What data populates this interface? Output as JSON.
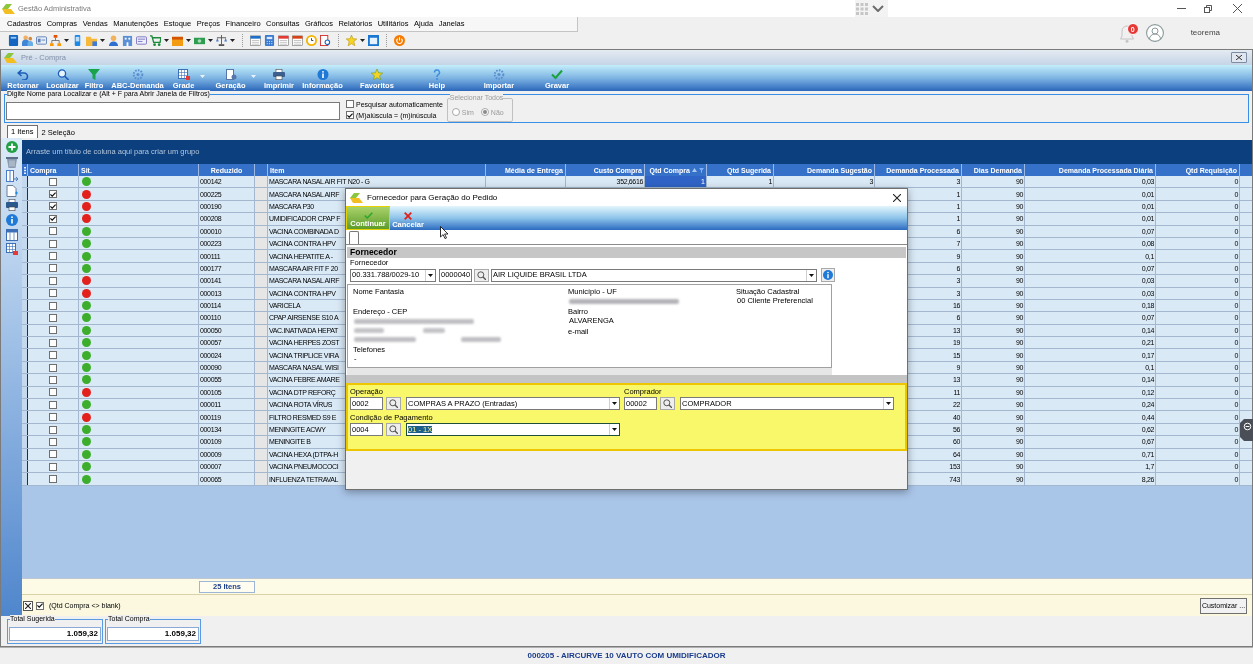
{
  "app": {
    "title": "Gestão Administrativa",
    "notifications": "0",
    "user": "teorema"
  },
  "menu": [
    "Cadastros",
    "Compras",
    "Vendas",
    "Manutenções",
    "Estoque",
    "Preços",
    "Financeiro",
    "Consultas",
    "Gráficos",
    "Relatórios",
    "Utilitários",
    "Ajuda",
    "Janelas"
  ],
  "window": {
    "title": "Pré - Compra"
  },
  "actions": [
    {
      "label": "Retornar",
      "dropdown": false
    },
    {
      "label": "Localizar",
      "dropdown": false
    },
    {
      "label": "Filtro",
      "dropdown": false
    },
    {
      "label": "ABC-Demanda",
      "dropdown": false
    },
    {
      "label": "Grade",
      "dropdown": true
    },
    {
      "label": "Geração",
      "dropdown": true
    },
    {
      "label": "Imprimir",
      "dropdown": false
    },
    {
      "label": "Informação",
      "dropdown": false
    },
    {
      "label": "Favoritos",
      "dropdown": false
    },
    {
      "label": "Help",
      "dropdown": false
    },
    {
      "label": "Importar",
      "dropdown": false
    },
    {
      "label": "Gravar",
      "dropdown": false
    }
  ],
  "search": {
    "label": "Digite Nome para Localizar e (Alt + F para Abrir Janela de Filtros)",
    "options": [
      {
        "label": "Pesquisar automaticamente",
        "checked": false
      },
      {
        "label": "(M)aiúscula = (m)inúscula",
        "checked": true
      }
    ],
    "select_all": {
      "title": "Selecionar Todos",
      "disabled": true,
      "options": [
        {
          "label": "Sim",
          "selected": false
        },
        {
          "label": "Não",
          "selected": true
        }
      ]
    }
  },
  "tabs": [
    {
      "label": "1 Itens",
      "selected": true
    },
    {
      "label": "2 Seleção",
      "selected": false
    }
  ],
  "grid": {
    "group_hint": "Arraste um título de coluna aqui para criar um grupo",
    "columns": [
      {
        "label": "Compra",
        "kind": "check"
      },
      {
        "label": "Sit.",
        "kind": "status"
      },
      {
        "label": "Reduzido",
        "kind": "code"
      },
      {
        "kind": "blank"
      },
      {
        "label": "Item",
        "kind": "text"
      },
      {
        "label": "Média de Entrega",
        "kind": "number"
      },
      {
        "label": "Custo Compra",
        "kind": "number"
      },
      {
        "label": "Qtd Compra",
        "kind": "number",
        "sort_ascending": true,
        "filtered": true
      },
      {
        "label": "Qtd Sugerida",
        "kind": "number"
      },
      {
        "label": "Demanda Sugestão",
        "kind": "number"
      },
      {
        "label": "Demanda Processada",
        "kind": "number"
      },
      {
        "label": "Dias Demanda",
        "kind": "number"
      },
      {
        "label": "Demanda Processada Diária",
        "kind": "number"
      },
      {
        "label": "Qtd Requisição",
        "kind": "number"
      }
    ],
    "rows": [
      {
        "cells": [
          {
            "checked": false
          },
          {
            "color": "#3cae2c"
          },
          "000142",
          "",
          "MASCARA NASAL AIR FIT N20 - G",
          "",
          "352,6616",
          {
            "text": "1",
            "selected": true
          },
          "1",
          "3",
          "3",
          "90",
          "0,03",
          "0"
        ]
      },
      {
        "cells": [
          {
            "checked": true
          },
          {
            "color": "#e3211c"
          },
          "000225",
          "",
          "MASCARA NASAL AIRF",
          "",
          "",
          "",
          "",
          "",
          "1",
          "90",
          "0,01",
          "0"
        ]
      },
      {
        "cells": [
          {
            "checked": true
          },
          {
            "color": "#e3211c"
          },
          "000190",
          "",
          "MASCARA P30",
          "",
          "",
          "",
          "",
          "",
          "1",
          "90",
          "0,01",
          "0"
        ]
      },
      {
        "cells": [
          {
            "checked": true
          },
          {
            "color": "#e3211c"
          },
          "000208",
          "",
          "UMIDIFICADOR CPAP F",
          "",
          "",
          "",
          "",
          "",
          "1",
          "90",
          "0,01",
          "0"
        ]
      },
      {
        "cells": [
          {
            "checked": false
          },
          {
            "color": "#3cae2c"
          },
          "000010",
          "",
          "VACINA COMBINADA D",
          "",
          "",
          "",
          "",
          "",
          "6",
          "90",
          "0,07",
          "0"
        ]
      },
      {
        "cells": [
          {
            "checked": false
          },
          {
            "color": "#3cae2c"
          },
          "000223",
          "",
          "VACINA CONTRA HPV",
          "",
          "",
          "",
          "",
          "",
          "7",
          "90",
          "0,08",
          "0"
        ]
      },
      {
        "cells": [
          {
            "checked": false
          },
          {
            "color": "#3cae2c"
          },
          "000111",
          "",
          "VACINA HEPATITE A -",
          "",
          "",
          "",
          "",
          "",
          "9",
          "90",
          "0,1",
          "0"
        ]
      },
      {
        "cells": [
          {
            "checked": false
          },
          {
            "color": "#3cae2c"
          },
          "000177",
          "",
          "MASCARA AIR FIT F 20",
          "",
          "",
          "",
          "",
          "",
          "6",
          "90",
          "0,07",
          "0"
        ]
      },
      {
        "cells": [
          {
            "checked": false
          },
          {
            "color": "#e3211c"
          },
          "000141",
          "",
          "MASCARA NASAL AIRF",
          "",
          "",
          "",
          "",
          "",
          "3",
          "90",
          "0,03",
          "0"
        ]
      },
      {
        "cells": [
          {
            "checked": false
          },
          {
            "color": "#e3211c"
          },
          "000013",
          "",
          "VACINA CONTRA HPV",
          "",
          "",
          "",
          "",
          "",
          "3",
          "90",
          "0,03",
          "0"
        ]
      },
      {
        "cells": [
          {
            "checked": false
          },
          {
            "color": "#3cae2c"
          },
          "000114",
          "",
          "VARICELA",
          "",
          "",
          "",
          "",
          "",
          "16",
          "90",
          "0,18",
          "0"
        ]
      },
      {
        "cells": [
          {
            "checked": false
          },
          {
            "color": "#3cae2c"
          },
          "000110",
          "",
          "CPAP AIRSENSE S10 A",
          "",
          "",
          "",
          "",
          "",
          "6",
          "90",
          "0,07",
          "0"
        ]
      },
      {
        "cells": [
          {
            "checked": false
          },
          {
            "color": "#3cae2c"
          },
          "000050",
          "",
          "VAC.INATIVADA HEPAT",
          "",
          "",
          "",
          "",
          "",
          "13",
          "90",
          "0,14",
          "0"
        ]
      },
      {
        "cells": [
          {
            "checked": false
          },
          {
            "color": "#3cae2c"
          },
          "000057",
          "",
          "VACINA HERPES ZOST",
          "",
          "",
          "",
          "",
          "",
          "19",
          "90",
          "0,21",
          "0"
        ]
      },
      {
        "cells": [
          {
            "checked": false
          },
          {
            "color": "#3cae2c"
          },
          "000024",
          "",
          "VACINA TRIPLICE VIRA",
          "",
          "",
          "",
          "",
          "",
          "15",
          "90",
          "0,17",
          "0"
        ]
      },
      {
        "cells": [
          {
            "checked": false
          },
          {
            "color": "#3cae2c"
          },
          "000090",
          "",
          "MASCARA NASAL WISI",
          "",
          "",
          "",
          "",
          "",
          "9",
          "90",
          "0,1",
          "0"
        ]
      },
      {
        "cells": [
          {
            "checked": false
          },
          {
            "color": "#3cae2c"
          },
          "000055",
          "",
          "VACINA FEBRE AMARE",
          "",
          "",
          "",
          "",
          "",
          "13",
          "90",
          "0,14",
          "0"
        ]
      },
      {
        "cells": [
          {
            "checked": false
          },
          {
            "color": "#e3211c"
          },
          "000105",
          "",
          "VACINA DTP REFORÇ",
          "",
          "",
          "",
          "",
          "",
          "11",
          "90",
          "0,12",
          "0"
        ]
      },
      {
        "cells": [
          {
            "checked": false
          },
          {
            "color": "#3cae2c"
          },
          "000011",
          "",
          "VACINA ROTA VÍRUS",
          "",
          "",
          "",
          "",
          "",
          "22",
          "90",
          "0,24",
          "0"
        ]
      },
      {
        "cells": [
          {
            "checked": false
          },
          {
            "color": "#e3211c"
          },
          "000119",
          "",
          "FILTRO RESMED S9 E",
          "",
          "",
          "",
          "",
          "",
          "40",
          "90",
          "0,44",
          "0"
        ]
      },
      {
        "cells": [
          {
            "checked": false
          },
          {
            "color": "#3cae2c"
          },
          "000134",
          "",
          "MENINGITE ACWY",
          "",
          "",
          "",
          "",
          "",
          "56",
          "90",
          "0,62",
          "0"
        ]
      },
      {
        "cells": [
          {
            "checked": false
          },
          {
            "color": "#3cae2c"
          },
          "000109",
          "",
          "MENINGITE B",
          "",
          "",
          "",
          "",
          "",
          "60",
          "90",
          "0,67",
          "0"
        ]
      },
      {
        "cells": [
          {
            "checked": false
          },
          {
            "color": "#3cae2c"
          },
          "000009",
          "",
          "VACINA HEXA (DTPA-H",
          "",
          "",
          "",
          "",
          "",
          "64",
          "90",
          "0,71",
          "0"
        ]
      },
      {
        "cells": [
          {
            "checked": false
          },
          {
            "color": "#3cae2c"
          },
          "000007",
          "",
          "VACINA PNEUMOCOCI",
          "",
          "",
          "",
          "",
          "",
          "153",
          "90",
          "1,7",
          "0"
        ]
      },
      {
        "cells": [
          {
            "checked": false
          },
          {
            "color": "#3cae2c"
          },
          "000065",
          "",
          "INFLUENZA TETRAVAL",
          "",
          "",
          "",
          "",
          "",
          "743",
          "90",
          "8,26",
          "0"
        ]
      }
    ],
    "row_count": "25 Itens",
    "filter": {
      "active": true,
      "expression": "(Qtd Compra <> blank)",
      "customize": "Customizar ..."
    }
  },
  "totals": [
    {
      "label": "Total Sugerida",
      "value": "1.059,32"
    },
    {
      "label": "Total Compra",
      "value": "1.059,32"
    }
  ],
  "status_bar": "000205 - AIRCURVE 10 VAUTO COM UMIDIFICADOR",
  "dialog": {
    "title": "Fornecedor para Geração do Pedido",
    "actions": [
      {
        "label": "Continuar",
        "kind": "confirm",
        "highlighted": true
      },
      {
        "label": "Cancelar",
        "kind": "cancel",
        "highlighted": false
      }
    ],
    "section": "Fornecedor",
    "supplier": {
      "label": "Fornecedor",
      "document": "00.331.788/0029-10",
      "code": "0000040",
      "name": "AIR LIQUIDE BRASIL LTDA"
    },
    "detail_columns": [
      {
        "fields": [
          {
            "label": "Nome Fantasia",
            "kind": "plain"
          },
          {
            "label": "Endereço - CEP",
            "kind": "blurblock"
          },
          {
            "label": "Telefones",
            "value": "-",
            "kind": "plain"
          }
        ]
      },
      {
        "fields": [
          {
            "label": "Município - UF",
            "kind": "blurline"
          },
          {
            "label": "Bairro",
            "value": "ALVARENGA",
            "kind": "plain"
          },
          {
            "label": "e-mail",
            "kind": "plain"
          }
        ]
      },
      {
        "fields": [
          {
            "label": "Situação Cadastral",
            "value": "00 Cliente Preferencial",
            "kind": "plain"
          }
        ]
      }
    ],
    "lookups": [
      {
        "label": "Operação",
        "code": "0002",
        "option": "COMPRAS A PRAZO (Entradas)",
        "focused": false
      },
      {
        "label": "Comprador",
        "code": "00002",
        "option": "COMPRADOR",
        "focused": false
      },
      {
        "label": "Condição de Pagamento",
        "code": "0004",
        "option": "01 - 1X",
        "focused": true
      }
    ]
  }
}
